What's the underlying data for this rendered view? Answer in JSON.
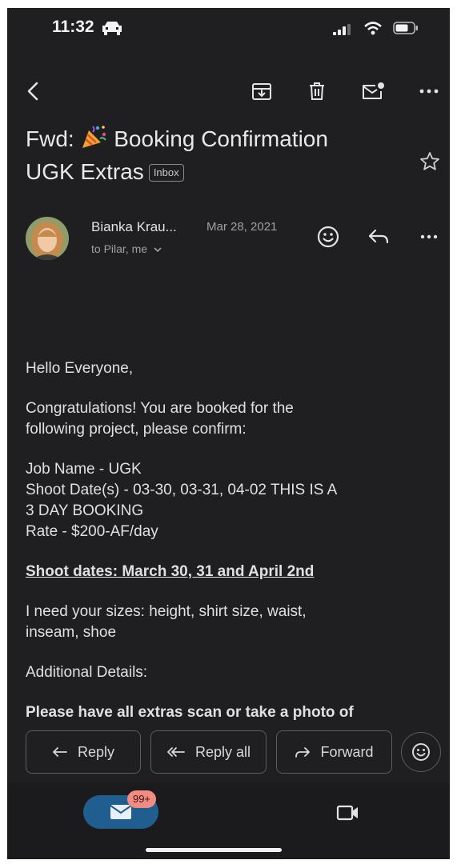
{
  "status_bar": {
    "time": "11:32"
  },
  "toolbar": {
    "icons": [
      "back-arrow-icon",
      "archive-icon",
      "trash-icon",
      "mark-unread-icon",
      "more-icon"
    ]
  },
  "email": {
    "subject_prefix": "Fwd:",
    "subject_emoji": "party-popper-icon",
    "subject_main": "Booking Confirmation",
    "subject_line2": "UGK Extras",
    "label": "Inbox",
    "sender_name": "Bianka Krau...",
    "date": "Mar 28, 2021",
    "recipients": "to Pilar, me"
  },
  "body": {
    "greeting": "Hello Everyone,",
    "congrats_1": "Congratulations! You are booked for the",
    "congrats_2": "following project, please confirm:",
    "job_name": "Job Name - UGK",
    "shoot_dates_1": "Shoot Date(s) - 03-30, 03-31, 04-02 THIS IS A",
    "shoot_dates_2": "3 DAY BOOKING",
    "rate": "Rate - $200-AF/day",
    "dates_summary": "Shoot dates: March 30, 31 and April 2nd",
    "sizes_1": "I need your sizes: height, shirt size, waist,",
    "sizes_2": "inseam, shoe",
    "additional": "Additional Details:",
    "scan_note": "Please have all extras scan or take a photo of"
  },
  "actions": {
    "reply": "Reply",
    "reply_all": "Reply all",
    "forward": "Forward"
  },
  "bottom_nav": {
    "mail_badge": "99+"
  },
  "colors": {
    "background": "#1f1f21",
    "accent_pill": "#1f5e8e",
    "badge": "#f28b82"
  }
}
